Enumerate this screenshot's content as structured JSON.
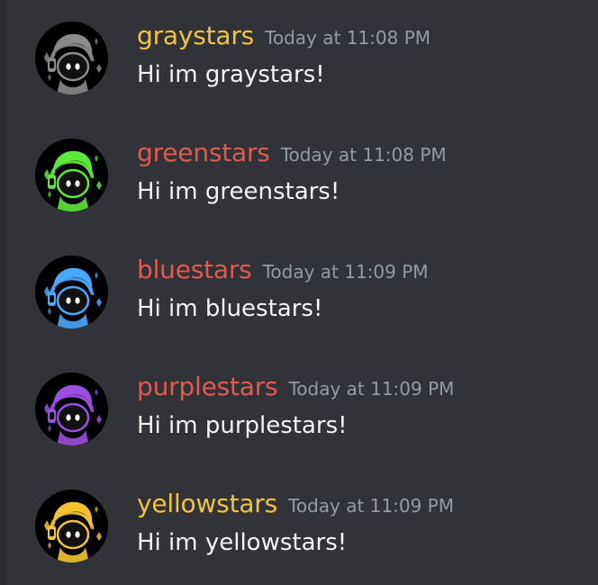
{
  "messages": [
    {
      "username": "graystars",
      "name_color": "#f0c443",
      "timestamp": "Today at 11:08 PM",
      "content": "Hi im graystars!",
      "avatar_color": "#8a8a8a"
    },
    {
      "username": "greenstars",
      "name_color": "#e05a4f",
      "timestamp": "Today at 11:08 PM",
      "content": "Hi im greenstars!",
      "avatar_color": "#5ee83a"
    },
    {
      "username": "bluestars",
      "name_color": "#e05a4f",
      "timestamp": "Today at 11:09 PM",
      "content": "Hi im bluestars!",
      "avatar_color": "#4aa8ff"
    },
    {
      "username": "purplestars",
      "name_color": "#e05a4f",
      "timestamp": "Today at 11:09 PM",
      "content": "Hi im purplestars!",
      "avatar_color": "#9b4fe0"
    },
    {
      "username": "yellowstars",
      "name_color": "#f0c443",
      "timestamp": "Today at 11:09 PM",
      "content": "Hi im yellowstars!",
      "avatar_color": "#f4c430"
    }
  ]
}
